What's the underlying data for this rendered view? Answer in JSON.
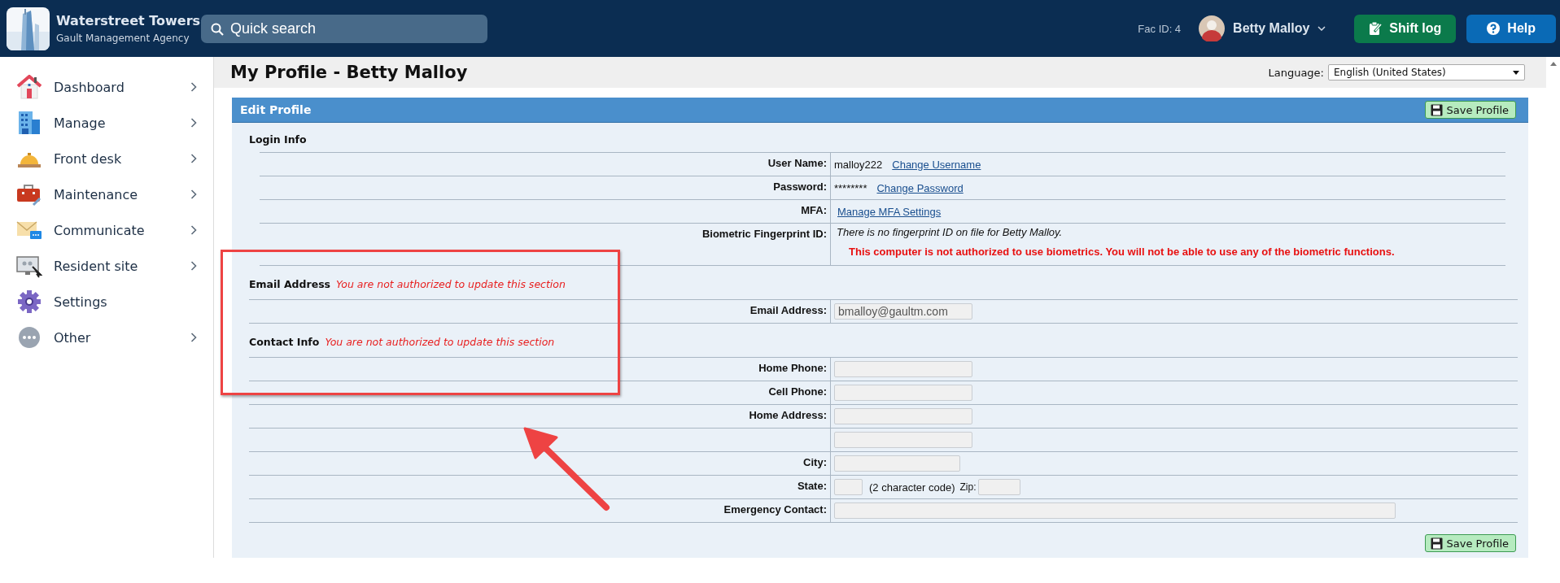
{
  "header": {
    "site_name": "Waterstreet Towers",
    "company": "Gault Management Agency",
    "search": {
      "placeholder": "Quick search"
    },
    "fac_id": "Fac ID: 4",
    "user": "Betty Malloy",
    "buttons": [
      {
        "label": "Shift log",
        "kind": "shift"
      },
      {
        "label": "Help",
        "kind": "help"
      }
    ]
  },
  "sidebar": {
    "items": [
      {
        "label": "Dashboard",
        "kind": "house",
        "submenu": true
      },
      {
        "label": "Manage",
        "kind": "buildings",
        "submenu": true
      },
      {
        "label": "Front desk",
        "kind": "bell",
        "submenu": true
      },
      {
        "label": "Maintenance",
        "kind": "toolbox",
        "submenu": true
      },
      {
        "label": "Communicate",
        "kind": "mail",
        "submenu": true
      },
      {
        "label": "Resident site",
        "kind": "monitor",
        "submenu": true
      },
      {
        "label": "Settings",
        "kind": "gear",
        "submenu": false
      },
      {
        "label": "Other",
        "kind": "dots",
        "submenu": true
      }
    ]
  },
  "page": {
    "title": "My Profile - Betty Malloy",
    "language": {
      "label": "Language:",
      "value": "English (United States)"
    }
  },
  "panel": {
    "title": "Edit Profile",
    "save_button": "Save Profile",
    "bottom_save_button": "Save Profile",
    "sections": [
      {
        "title": "Login Info",
        "rows": [
          {
            "label": "User Name:",
            "items": [
              {
                "kind": "text",
                "text": "malloy222"
              },
              {
                "kind": "link",
                "text": "Change Username"
              }
            ]
          },
          {
            "label": "Password:",
            "items": [
              {
                "kind": "text",
                "text": "********"
              },
              {
                "kind": "link",
                "text": "Change Password"
              }
            ]
          },
          {
            "label": "MFA:",
            "items": [
              {
                "kind": "link",
                "text": "Manage MFA Settings"
              }
            ]
          },
          {
            "label": "Biometric Fingerprint ID:",
            "items": [
              {
                "kind": "note",
                "text": "There is no fingerprint ID on file for Betty Malloy."
              },
              {
                "kind": "error",
                "text": "This computer is not authorized to use biometrics. You will not be able to use any of the biometric functions."
              }
            ]
          }
        ]
      },
      {
        "title": "Email Address",
        "notice": "You are not authorized to update this section",
        "rows": [
          {
            "label": "Email Address:",
            "items": [
              {
                "kind": "field",
                "value": "bmalloy@gaultm.com"
              }
            ]
          }
        ]
      },
      {
        "title": "Contact Info",
        "notice": "You are not authorized to update this section",
        "rows": [
          {
            "label": "Home Phone:",
            "items": [
              {
                "kind": "field"
              }
            ]
          },
          {
            "label": "Cell Phone:",
            "items": [
              {
                "kind": "field"
              }
            ]
          },
          {
            "label": "Home Address:",
            "items": [
              {
                "kind": "field"
              }
            ]
          },
          {
            "items": [
              {
                "kind": "field"
              }
            ]
          },
          {
            "label": "City:",
            "items": [
              {
                "kind": "short-field"
              }
            ]
          },
          {
            "label": "State:",
            "items": [
              {
                "kind": "code-field"
              },
              {
                "kind": "text",
                "text": "(2 character code)"
              },
              {
                "kind": "small-label",
                "text": "Zip:"
              },
              {
                "kind": "zip-field"
              }
            ]
          },
          {
            "label": "Emergency Contact:",
            "items": [
              {
                "kind": "long-field"
              }
            ]
          }
        ]
      }
    ]
  }
}
